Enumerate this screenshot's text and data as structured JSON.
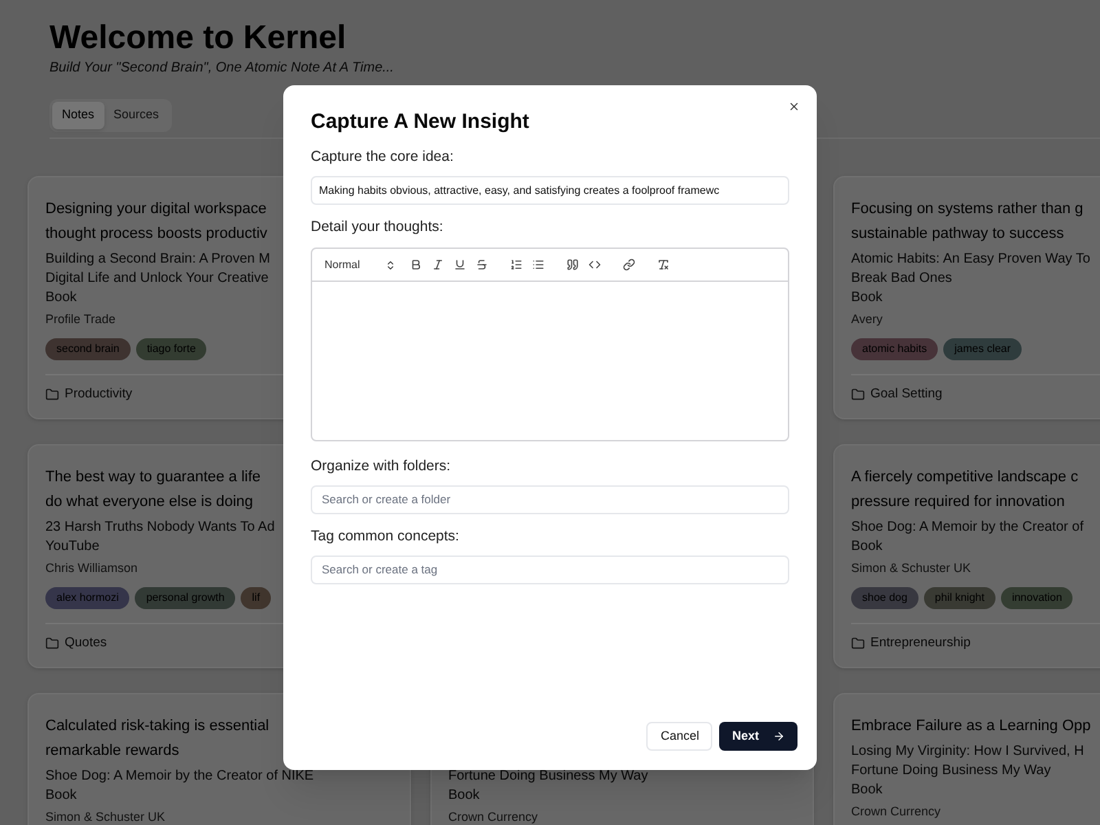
{
  "header": {
    "title": "Welcome to Kernel",
    "subtitle": "Build Your \"Second Brain\", One Atomic Note At A Time..."
  },
  "tabs": [
    {
      "label": "Notes",
      "selected": true
    },
    {
      "label": "Sources",
      "selected": false
    }
  ],
  "rows": [
    {
      "column_1": {
        "title": [
          "Designing your digital workspace",
          "thought process boosts productiv"
        ],
        "source": [
          "Building a Second Brain: A Proven M",
          "Digital Life and Unlock Your Creative",
          "Book"
        ],
        "author": "Profile Trade",
        "tags": [
          {
            "label": "second brain",
            "color": "#3e3330"
          },
          {
            "label": "tiago forte",
            "color": "#333c31"
          }
        ],
        "folder": "Productivity"
      },
      "column_3": {
        "title": [
          "Focusing on systems rather than g",
          "sustainable pathway to success"
        ],
        "source": [
          "Atomic Habits: An Easy Proven Way To",
          "Break Bad Ones",
          "Book"
        ],
        "author": "Avery",
        "tags": [
          {
            "label": "atomic habits",
            "color": "#473339"
          },
          {
            "label": "james clear",
            "color": "#2f3c3d"
          }
        ],
        "folder": "Goal Setting"
      }
    },
    {
      "column_1": {
        "title": [
          "The best way to guarantee a life",
          "do what everyone else is doing"
        ],
        "source": [
          "23 Harsh Truths Nobody Wants To Ad",
          "YouTube"
        ],
        "author": "Chris Williamson",
        "tags": [
          {
            "label": "alex hormozi",
            "color": "#35354a"
          },
          {
            "label": "personal growth",
            "color": "#323a35"
          },
          {
            "label": "lif",
            "color": "#41362e"
          }
        ],
        "folder": "Quotes"
      },
      "column_3": {
        "title": [
          "A fiercely competitive landscape c",
          "pressure required for innovation"
        ],
        "source": [
          "Shoe Dog: A Memoir by the Creator of",
          "Book"
        ],
        "author": "Simon & Schuster UK",
        "tags": [
          {
            "label": "shoe dog",
            "color": "#383840"
          },
          {
            "label": "phil knight",
            "color": "#393a33"
          },
          {
            "label": "innovation",
            "color": "#343d32"
          }
        ],
        "folder": "Entrepreneurship"
      }
    },
    {
      "column_1": {
        "title": [
          "Calculated risk-taking is essential",
          "remarkable rewards"
        ],
        "source": [
          "Shoe Dog: A Memoir by the Creator of NIKE",
          "Book"
        ],
        "author": "Simon & Schuster UK"
      },
      "column_2": {
        "source": [
          "Fortune Doing Business My Way",
          "Book"
        ],
        "author": "Crown Currency"
      },
      "column_3": {
        "title": [
          "Embrace Failure as a Learning Opp"
        ],
        "source": [
          "Losing My Virginity: How I Survived, H",
          "Fortune Doing Business My Way",
          "Book"
        ],
        "author": "Crown Currency"
      }
    }
  ],
  "modal": {
    "title": "Capture A New Insight",
    "core_label": "Capture the core idea:",
    "core_value": "Making habits obvious, attractive, easy, and satisfying creates a foolproof framewc",
    "detail_label": "Detail your thoughts:",
    "format": "Normal",
    "folders_label": "Organize with folders:",
    "folders_placeholder": "Search or create a folder",
    "tags_label": "Tag common concepts:",
    "tags_placeholder": "Search or create a tag",
    "buttons": [
      {
        "label": "Cancel",
        "kind": "secondary"
      },
      {
        "label": "Next",
        "kind": "primary"
      }
    ]
  }
}
